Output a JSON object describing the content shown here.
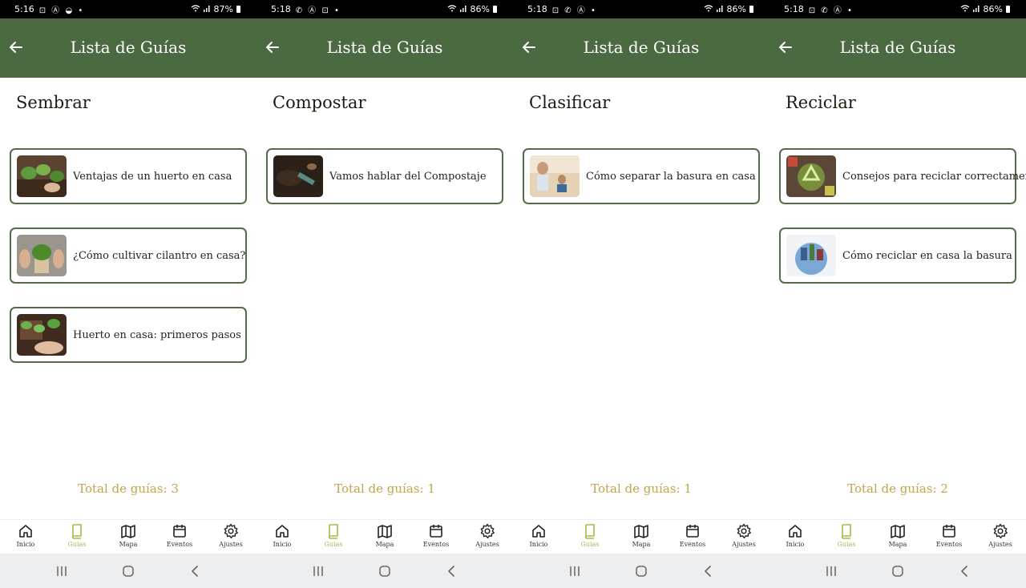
{
  "colors": {
    "app_bar": "#4c6a42",
    "card_border": "#556b45",
    "total_text": "#c2a44a",
    "nav_active": "#a7b84a",
    "status_bar": "#000000",
    "system_nav": "#eceef0"
  },
  "screens": [
    {
      "status": {
        "time": "5:16",
        "notif_icons": "⊡ Ⓐ ◒ •",
        "battery": "87%"
      },
      "app_title": "Lista de Guías",
      "category": "Sembrar",
      "guides": [
        {
          "label": "Ventajas de un huerto en casa",
          "thumb": "garden-hands-photo"
        },
        {
          "label": "¿Cómo cultivar cilantro en casa?",
          "thumb": "potted-herb-photo"
        },
        {
          "label": "Huerto en casa: primeros pasos",
          "thumb": "seedlings-photo"
        }
      ],
      "total": {
        "label": "Total de guías:",
        "count": "3"
      }
    },
    {
      "status": {
        "time": "5:18",
        "notif_icons": "✆ Ⓐ ⊡ •",
        "battery": "86%"
      },
      "app_title": "Lista de Guías",
      "category": "Compostar",
      "guides": [
        {
          "label": "Vamos hablar del Compostaje",
          "thumb": "compost-soil-photo"
        }
      ],
      "total": {
        "label": "Total de guías:",
        "count": "1"
      }
    },
    {
      "status": {
        "time": "5:18",
        "notif_icons": "⊡ ✆ Ⓐ •",
        "battery": "86%"
      },
      "app_title": "Lista de Guías",
      "category": "Clasificar",
      "guides": [
        {
          "label": "Cómo separar la basura en casa",
          "thumb": "family-sorting-photo"
        }
      ],
      "total": {
        "label": "Total de guías:",
        "count": "1"
      }
    },
    {
      "status": {
        "time": "5:18",
        "notif_icons": "⊡ ✆ Ⓐ •",
        "battery": "86%"
      },
      "app_title": "Lista de Guías",
      "category": "Reciclar",
      "guides": [
        {
          "label": "Consejos para reciclar correctamente",
          "thumb": "recycle-symbol-photo"
        },
        {
          "label": "Cómo reciclar en casa la basura",
          "thumb": "recycling-globe-photo"
        }
      ],
      "total": {
        "label": "Total de guías:",
        "count": "2"
      }
    }
  ],
  "bottom_nav": [
    {
      "label": "Inicio",
      "icon": "home-icon"
    },
    {
      "label": "Guías",
      "icon": "book-icon",
      "active": true
    },
    {
      "label": "Mapa",
      "icon": "map-icon"
    },
    {
      "label": "Eventos",
      "icon": "calendar-icon"
    },
    {
      "label": "Ajustes",
      "icon": "gear-icon"
    }
  ],
  "system_nav": [
    "recents-icon",
    "home-button-icon",
    "back-nav-icon"
  ]
}
